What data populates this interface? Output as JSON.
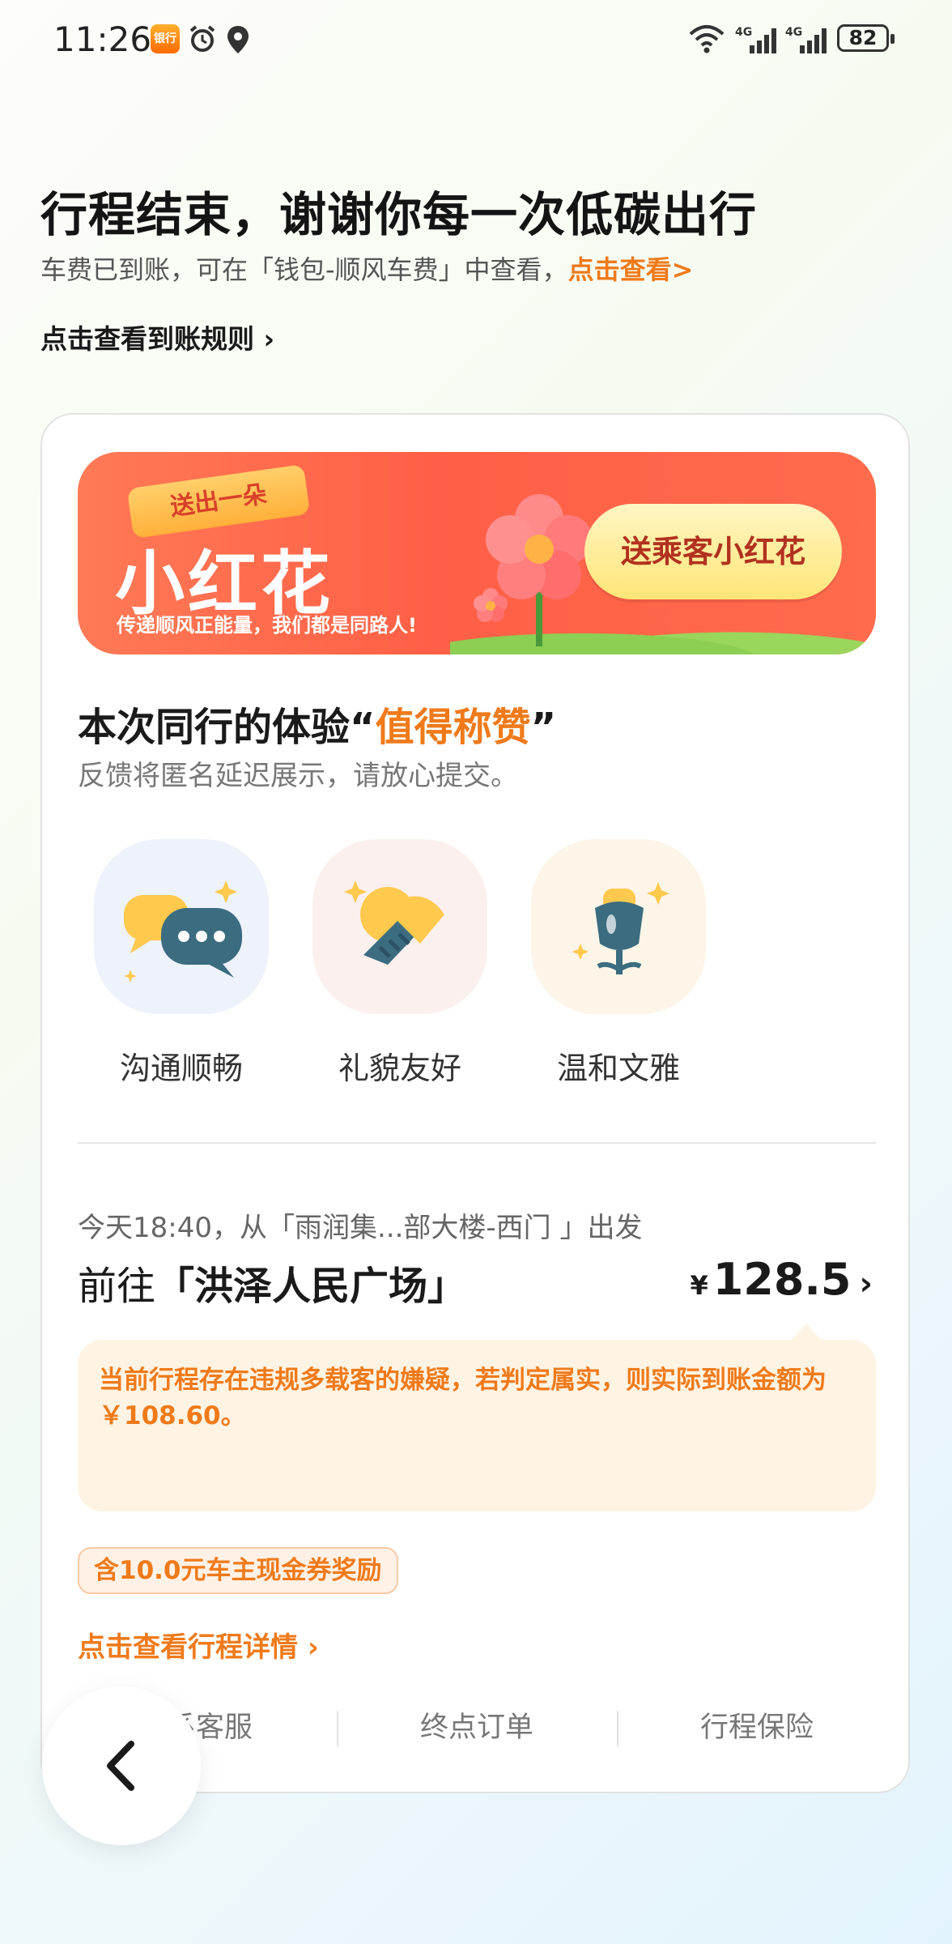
{
  "status_bar": {
    "time": "11:26",
    "app_badge": "银行",
    "battery": "82",
    "network1": "4G",
    "network2": "4G"
  },
  "header": {
    "title": "行程结束，谢谢你每一次低碳出行",
    "subtitle": "车费已到账，可在「钱包-顺风车费」中查看，",
    "subtitle_link": "点击查看>",
    "rules_link": "点击查看到账规则 ›"
  },
  "banner": {
    "tag": "送出一朵",
    "big_text": "小红花",
    "slogan": "传递顺风正能量，我们都是同路人!",
    "button": "送乘客小红花"
  },
  "experience": {
    "title_prefix": "本次同行的体验“",
    "title_highlight": "值得称赞",
    "title_suffix": "”",
    "subtitle": "反馈将匿名延迟展示，请放心提交。",
    "options": [
      {
        "label": "沟通顺畅",
        "icon": "chat-bubbles-icon"
      },
      {
        "label": "礼貌友好",
        "icon": "handshake-icon"
      },
      {
        "label": "温和文雅",
        "icon": "flower-icon"
      }
    ]
  },
  "trip": {
    "departure": "今天18:40，从「雨润集...部大楼-西门 」出发",
    "dest_prefix": "前往",
    "destination": "「洪泽人民广场」",
    "currency": "¥",
    "price": "128.5",
    "warning": "当前行程存在违规多载客的嫌疑，若判定属实，则实际到账金额为￥108.60。",
    "coupon": "含10.0元车主现金券奖励",
    "detail_link": "点击查看行程详情 ›"
  },
  "actions": [
    "联系客服",
    "终点订单",
    "行程保险"
  ],
  "colors": {
    "accent": "#f07a1a",
    "banner": "#ff5f46",
    "warning_bg": "#fff4e4"
  }
}
